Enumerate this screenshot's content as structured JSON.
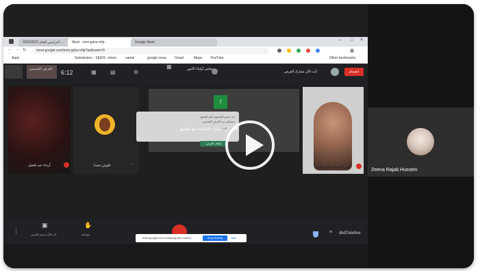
{
  "browser": {
    "tabs": [
      {
        "label": "2020/2021 الدراسي العام ..."
      },
      {
        "label": "Meet - irxm-gdve-mfp"
      },
      {
        "label": "Google Meet"
      }
    ],
    "address": "meet.google.com/irxm-gdve-mfp?authuser=0",
    "bookmarks": [
      {
        "label": "Apps"
      },
      {
        "label": "Submission - SEEIS"
      },
      {
        "label": "chess"
      },
      {
        "label": "camel"
      },
      {
        "label": "google news"
      },
      {
        "label": "Gmail"
      },
      {
        "label": "Maps"
      },
      {
        "label": "YouTube"
      },
      {
        "label": "Other bookmarks"
      }
    ]
  },
  "meet": {
    "time": "6:12",
    "join_label": "انضمام",
    "header_right": "أنت الآن تشارك العرض",
    "header_title": "مجلس أولياء الأمور",
    "presenter_label": "العرض التقديمي"
  },
  "tiles": [
    {
      "name": "أرجاء عبد فاضل"
    },
    {
      "name": "علوش حسنا"
    },
    {
      "name": "علي المصري علي نبلاني"
    }
  ],
  "dialog": {
    "line1": "بدء عرض المحتوى أمام الجميع",
    "line2": "ستتمكن من العرض التقديمي",
    "line3": "إيقاف العرض",
    "share_line": "أنت الآن تشارك الشاشة مع الجميع",
    "present_btn": "إيقاف العرض"
  },
  "bottom": {
    "caption_label": "أنت الآن تعرض العرض",
    "raise_label": "رفع اليد",
    "share_text": "meet.google.com is sharing your screen.",
    "stop_label": "Stop sharing",
    "hide_label": "Hide",
    "meeting_code": "dkd7xkebxx"
  },
  "side": {
    "name": "Zeena Rajab Hussein"
  },
  "video": {
    "play_icon": "play-icon"
  }
}
